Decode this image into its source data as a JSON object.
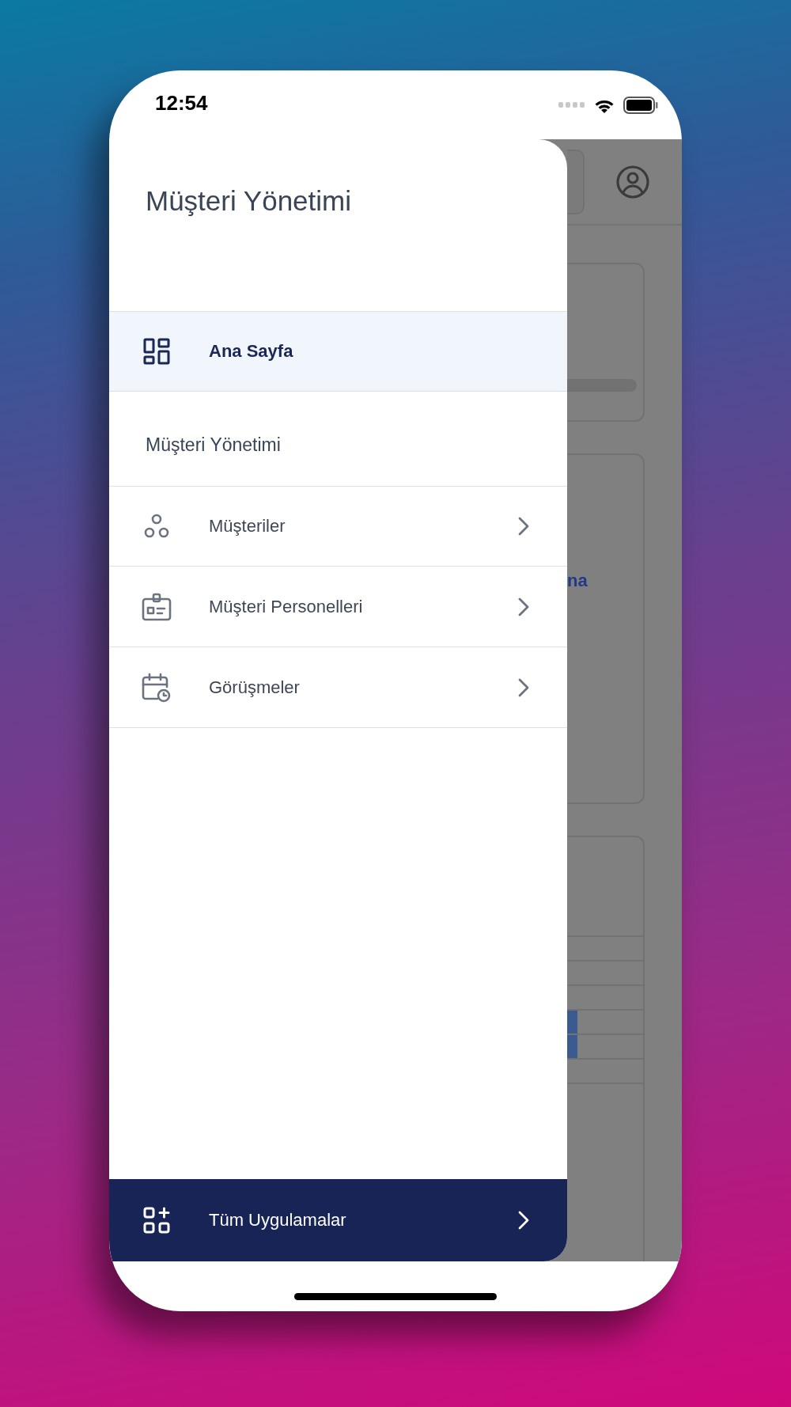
{
  "status_bar": {
    "time": "12:54"
  },
  "drawer": {
    "title": "Müşteri Yönetimi",
    "items": [
      {
        "label": "Ana Sayfa",
        "kind": "home",
        "selected": true
      }
    ],
    "section": {
      "label": "Müşteri Yönetimi",
      "items": [
        {
          "label": "Müşteriler",
          "kind": "customers",
          "selected": false
        },
        {
          "label": "Müşteri Personelleri",
          "kind": "staff",
          "selected": false
        },
        {
          "label": "Görüşmeler",
          "kind": "meetings",
          "selected": false
        }
      ]
    },
    "footer": {
      "label": "Tüm Uygulamalar"
    }
  },
  "background": {
    "fragment": "na"
  }
}
